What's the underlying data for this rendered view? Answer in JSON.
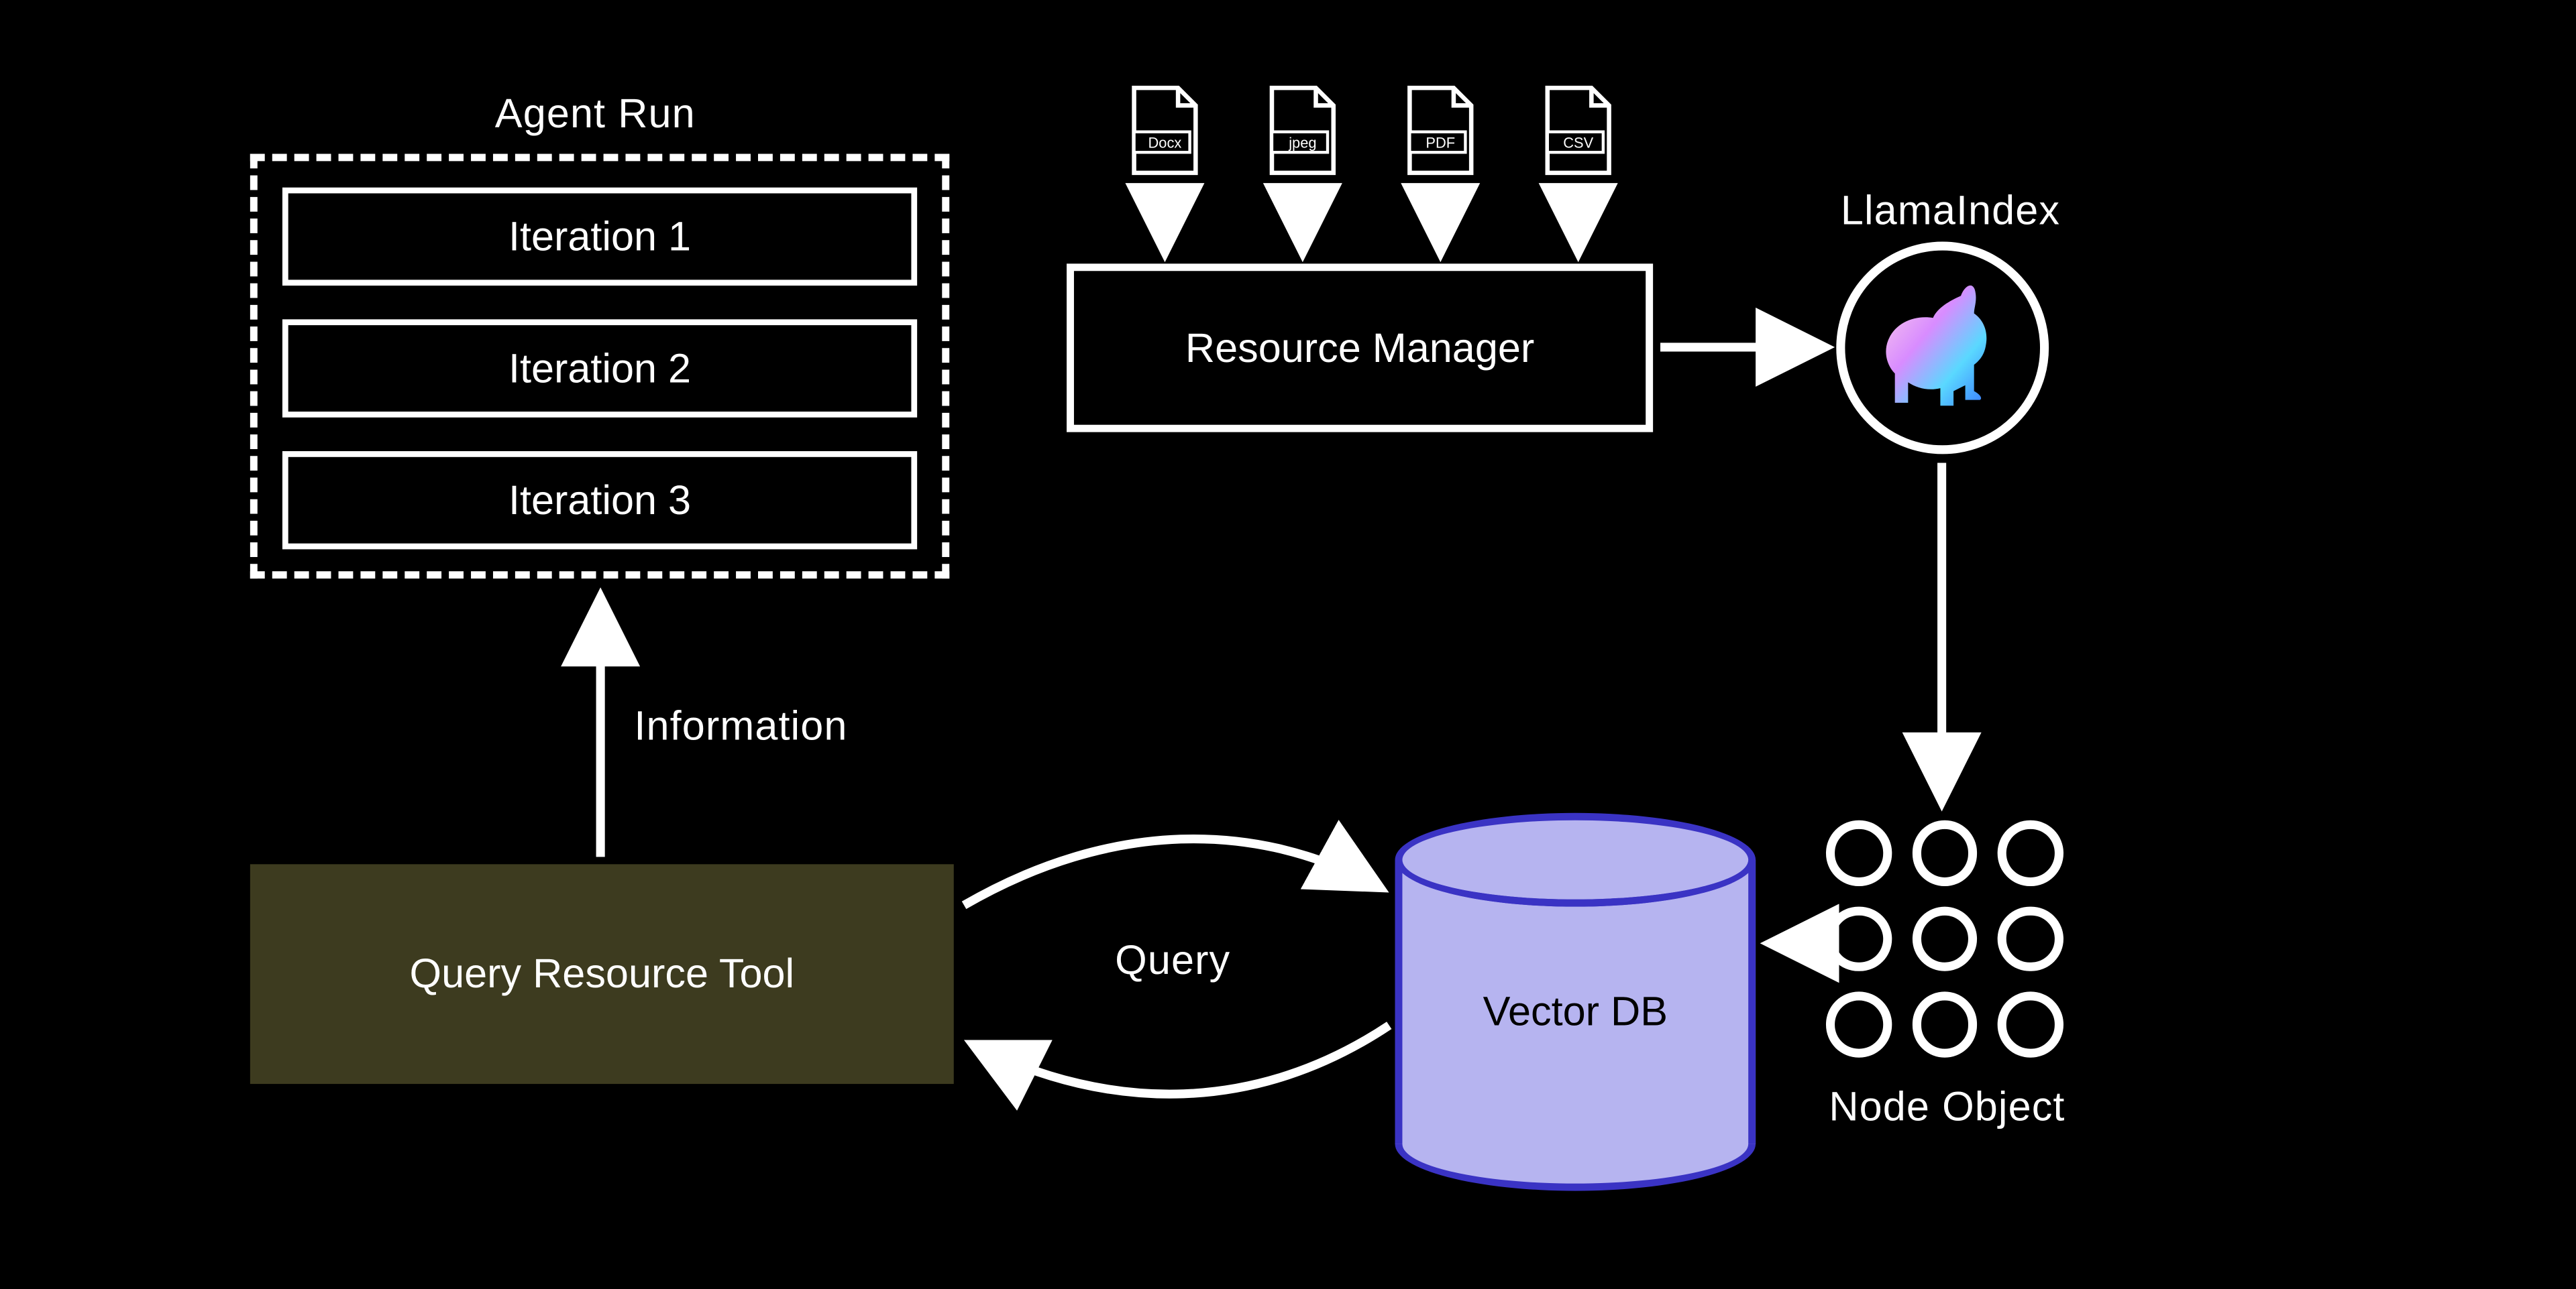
{
  "agent_run": {
    "title": "Agent Run",
    "iterations": [
      "Iteration 1",
      "Iteration 2",
      "Iteration 3"
    ]
  },
  "files": {
    "types": [
      "Docx",
      "jpeg",
      "PDF",
      "CSV"
    ]
  },
  "resource_manager": {
    "label": "Resource Manager"
  },
  "llamaindex": {
    "label": "LlamaIndex"
  },
  "query_tool": {
    "label": "Query Resource Tool"
  },
  "vector_db": {
    "label": "Vector DB"
  },
  "node_object": {
    "label": "Node Object"
  },
  "edges": {
    "information": "Information",
    "query": "Query"
  },
  "colors": {
    "background": "#000000",
    "stroke": "#ffffff",
    "query_tool_bg": "#3d3b1f",
    "vector_db_fill": "#b6b4f0",
    "vector_db_stroke": "#3a33c4"
  }
}
